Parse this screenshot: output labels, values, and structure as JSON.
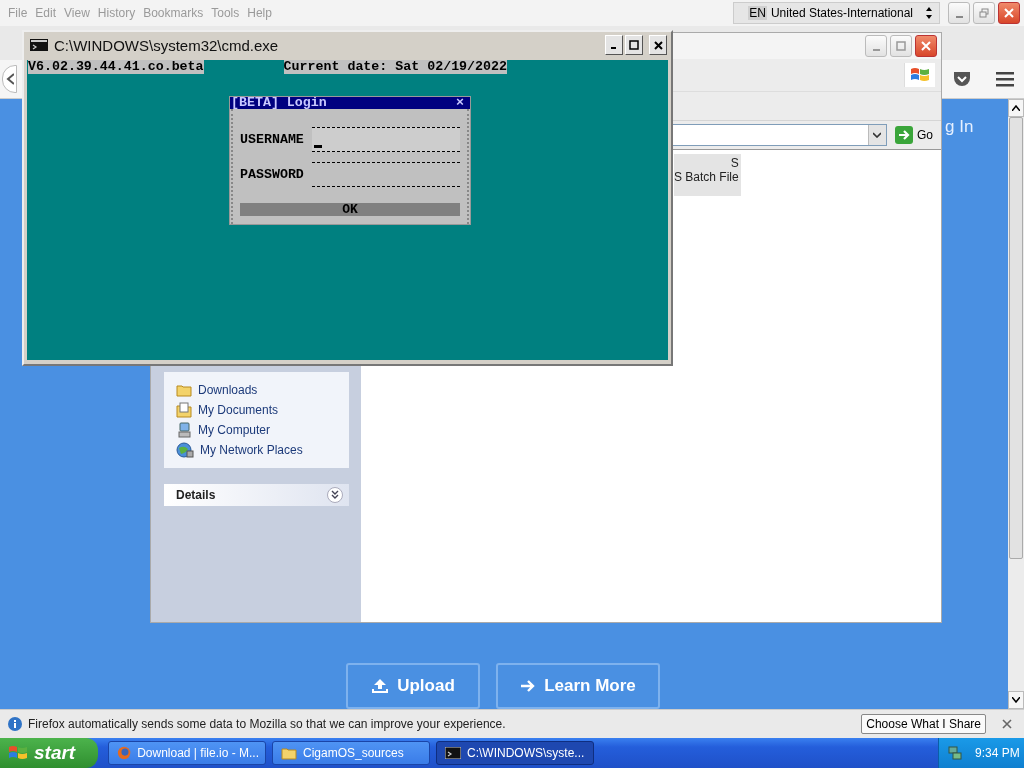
{
  "menu_bar": {
    "items": [
      {
        "label": "File"
      },
      {
        "label": "Edit"
      },
      {
        "label": "View"
      },
      {
        "label": "History"
      },
      {
        "label": "Bookmarks"
      },
      {
        "label": "Tools"
      },
      {
        "label": "Help"
      }
    ],
    "disabled": true
  },
  "language_bar": {
    "code": "EN",
    "layout": "United States-International"
  },
  "page": {
    "login_link": "g In",
    "buttons": [
      {
        "label": "Upload",
        "kind": "upload"
      },
      {
        "label": "Learn More",
        "kind": "arrow"
      }
    ]
  },
  "notification": {
    "text": "Firefox automatically sends some data to Mozilla so that we can improve your experience.",
    "button": "Choose What I Share"
  },
  "explorer": {
    "go": "Go",
    "file": {
      "line_1": "S",
      "line_2": "S Batch File"
    },
    "other_places": [
      {
        "label": "Downloads",
        "kind": "folder"
      },
      {
        "label": "My Documents",
        "kind": "documents"
      },
      {
        "label": "My Computer",
        "kind": "computer"
      },
      {
        "label": "My Network Places",
        "kind": "network"
      }
    ],
    "details_title": "Details"
  },
  "console": {
    "title": "C:\\WINDOWS\\system32\\cmd.exe",
    "version": "V6.02.39.44.41.co.beta",
    "date_line": "Current date: Sat 02/19/2022",
    "dialog": {
      "title": "[BETA] Login",
      "close": "×",
      "fields": [
        {
          "label": "USERNAME",
          "focused": true
        },
        {
          "label": "PASSWORD",
          "focused": false
        }
      ],
      "ok": "OK"
    }
  },
  "taskbar": {
    "start": "start",
    "tasks": [
      {
        "label": "Download | file.io - M...",
        "kind": "firefox",
        "selected": false
      },
      {
        "label": "CigamOS_sources",
        "kind": "folder",
        "selected": false
      },
      {
        "label": "C:\\WINDOWS\\syste...",
        "kind": "console",
        "selected": true
      }
    ],
    "clock": "9:34 PM"
  }
}
